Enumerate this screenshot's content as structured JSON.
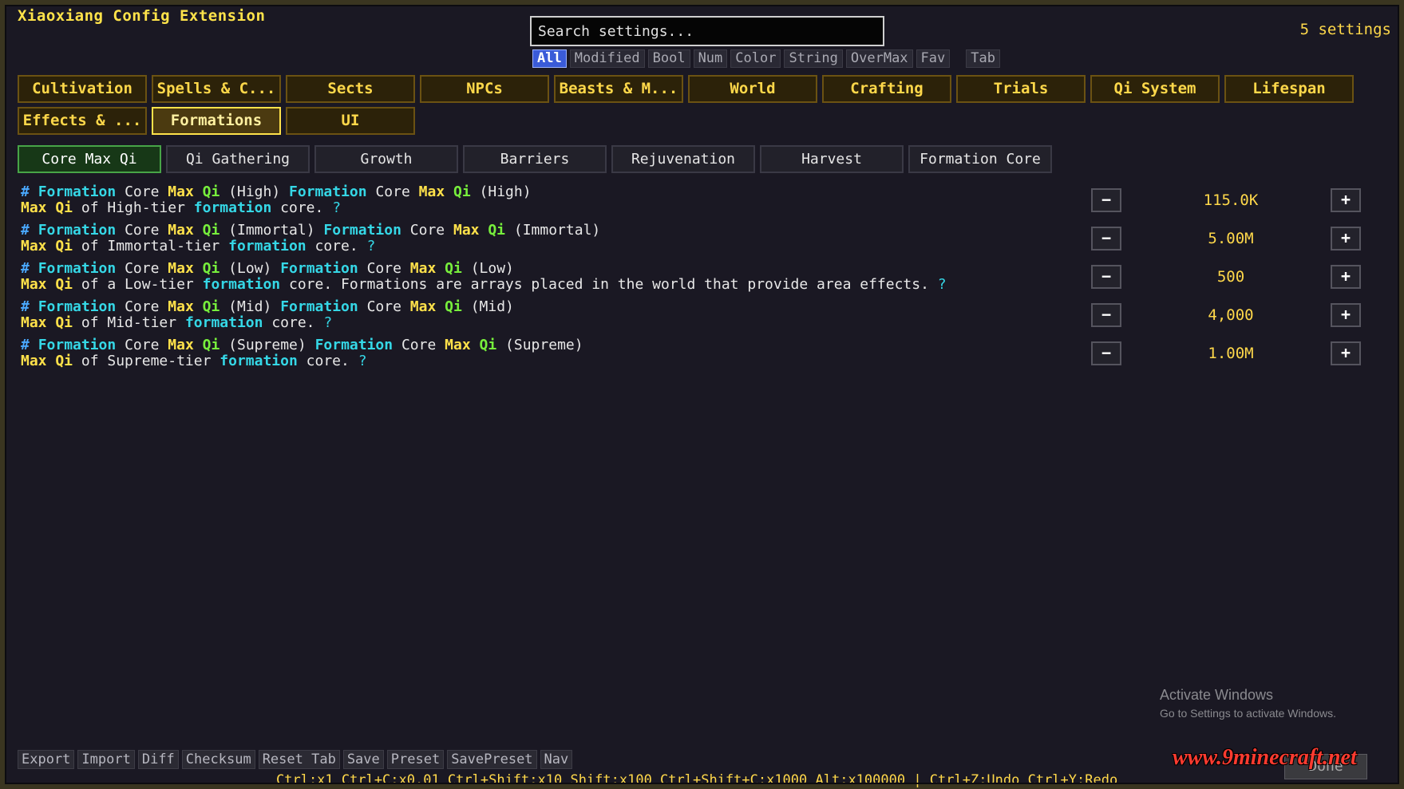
{
  "app": {
    "title": "Xiaoxiang Config Extension",
    "settings_count": "5 settings"
  },
  "search": {
    "placeholder": "Search settings..."
  },
  "filters": [
    {
      "label": "All",
      "active": true
    },
    {
      "label": "Modified"
    },
    {
      "label": "Bool"
    },
    {
      "label": "Num"
    },
    {
      "label": "Color"
    },
    {
      "label": "String"
    },
    {
      "label": "OverMax"
    },
    {
      "label": "Fav"
    },
    {
      "label": "Tab"
    }
  ],
  "categories_row1": [
    "Cultivation",
    "Spells & C...",
    "Sects",
    "NPCs",
    "Beasts & M...",
    "World",
    "Crafting",
    "Trials",
    "Qi System",
    "Lifespan"
  ],
  "categories_row2": [
    "Effects & ...",
    "Formations",
    "UI"
  ],
  "active_category": "Formations",
  "subtabs": [
    "Core Max Qi",
    "Qi Gathering",
    "Growth",
    "Barriers",
    "Rejuvenation",
    "Harvest",
    "Formation Core"
  ],
  "active_subtab": "Core Max Qi",
  "words": {
    "hash": "#",
    "formation": "Formation",
    "core": "Core",
    "max": "Max",
    "qi": "Qi",
    "max_qi": "Max Qi",
    "of": "of",
    "formation_lc": "formation",
    "core_dot": "core.",
    "q": "?"
  },
  "entries": [
    {
      "tier": "(High)",
      "desc_mid": "of High-tier",
      "value": "115.0K"
    },
    {
      "tier": "(Immortal)",
      "desc_mid": "of Immortal-tier",
      "value": "5.00M"
    },
    {
      "tier": "(Low)",
      "desc_mid": "of a Low-tier",
      "desc_tail": "core. Formations are arrays placed in the world that provide area effects.",
      "value": "500"
    },
    {
      "tier": "(Mid)",
      "desc_mid": "of Mid-tier",
      "value": "4,000"
    },
    {
      "tier": "(Supreme)",
      "desc_mid": "of Supreme-tier",
      "value": "1.00M"
    }
  ],
  "buttons": {
    "minus": "−",
    "plus": "+"
  },
  "bottom_bar": [
    "Export",
    "Import",
    "Diff",
    "Checksum",
    "Reset Tab",
    "Save",
    "Preset",
    "SavePreset",
    "Nav"
  ],
  "shortcuts": "Ctrl:x1  Ctrl+C:x0.01  Ctrl+Shift:x10  Shift:x100  Ctrl+Shift+C:x1000  Alt:x100000  |  Ctrl+Z:Undo  Ctrl+Y:Redo",
  "overlay": {
    "activate_title": "Activate Windows",
    "activate_sub": "Go to Settings to activate Windows.",
    "done_label": "Done",
    "logo_text": "www.9minecraft.net"
  },
  "colors": {
    "accent_yellow": "#ffd84a",
    "accent_cyan": "#35d7e6",
    "accent_lime": "#77ee3c",
    "active_filter": "#3a5bd8",
    "active_subtab": "#47a447"
  }
}
